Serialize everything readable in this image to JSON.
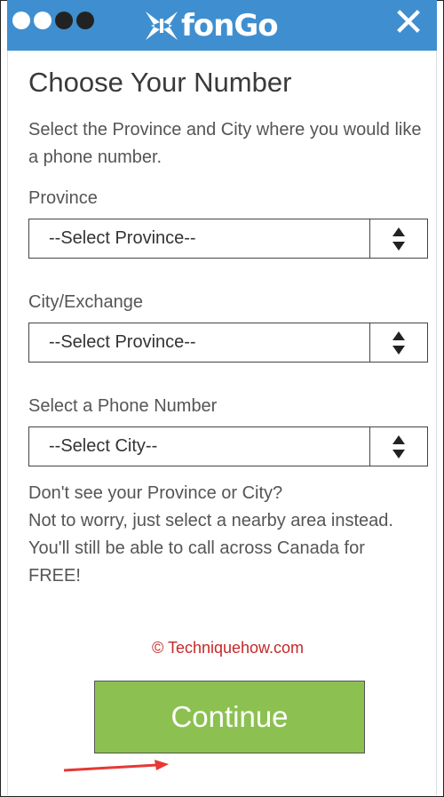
{
  "header": {
    "brand": "fonGo",
    "close_symbol": "✕",
    "background_color": "#3f8fd0"
  },
  "main": {
    "title": "Choose Your Number",
    "intro": "Select the Province and City where you would like a phone number.",
    "fields": [
      {
        "label": "Province",
        "selected": "--Select Province--"
      },
      {
        "label": "City/Exchange",
        "selected": "--Select Province--"
      },
      {
        "label": "Select a Phone Number",
        "selected": "--Select City--"
      }
    ],
    "note_lines": [
      "Don't see your Province or City?",
      "Not to worry, just select a nearby area instead.",
      "You'll still be able to call across Canada for",
      "FREE!"
    ],
    "continue_label": "Continue",
    "button_color": "#8cc152"
  },
  "watermark": "© Techniquehow.com"
}
